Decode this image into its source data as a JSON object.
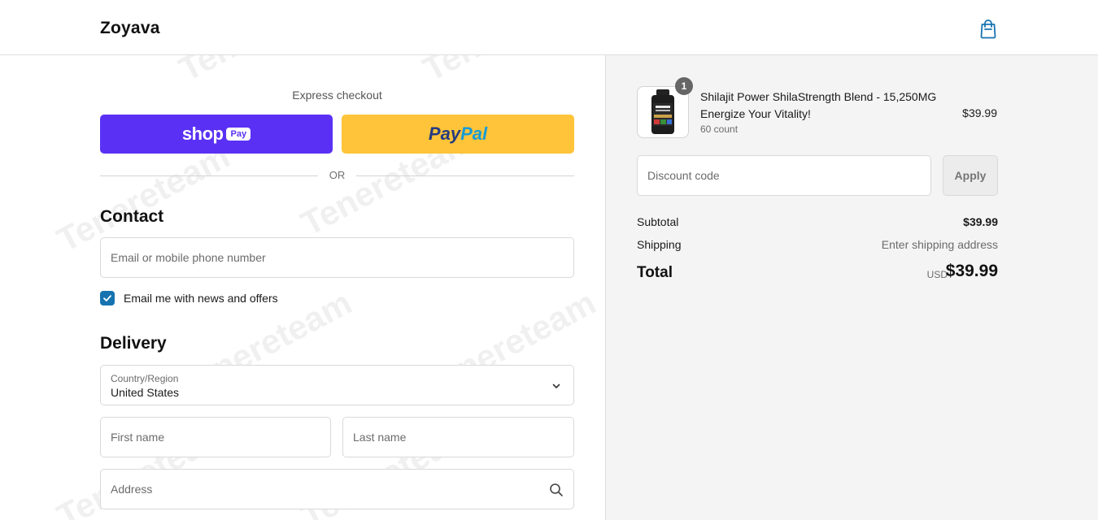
{
  "brand": "Zoyava",
  "express": {
    "label": "Express checkout",
    "shop_word": "shop",
    "shop_pill": "Pay",
    "paypal_a": "Pay",
    "paypal_b": "Pal",
    "or_text": "OR"
  },
  "contact": {
    "title": "Contact",
    "email_placeholder": "Email or mobile phone number",
    "newsletter_label": "Email me with news and offers",
    "newsletter_checked": true
  },
  "delivery": {
    "title": "Delivery",
    "country_label": "Country/Region",
    "country_value": "United States",
    "first_name_placeholder": "First name",
    "last_name_placeholder": "Last name",
    "address_placeholder": "Address"
  },
  "summary": {
    "item": {
      "quantity": "1",
      "name": "Shilajit Power ShilaStrength Blend - 15,250MG Energize Your Vitality!",
      "variant": "60 count",
      "price": "$39.99"
    },
    "discount_placeholder": "Discount code",
    "apply_label": "Apply",
    "subtotal_label": "Subtotal",
    "subtotal_value": "$39.99",
    "shipping_label": "Shipping",
    "shipping_value": "Enter shipping address",
    "total_label": "Total",
    "total_currency": "USD",
    "total_value": "$39.99"
  },
  "watermark": "Tenereteam",
  "colors": {
    "shop_pay": "#5a31f4",
    "paypal": "#ffc439",
    "checkbox": "#1773b0",
    "summary_bg": "#f4f4f4"
  },
  "icons": {
    "cart": "shopping-bag-icon",
    "select": "chevron-down-icon",
    "address": "search-icon",
    "checkbox": "checkmark-icon"
  }
}
